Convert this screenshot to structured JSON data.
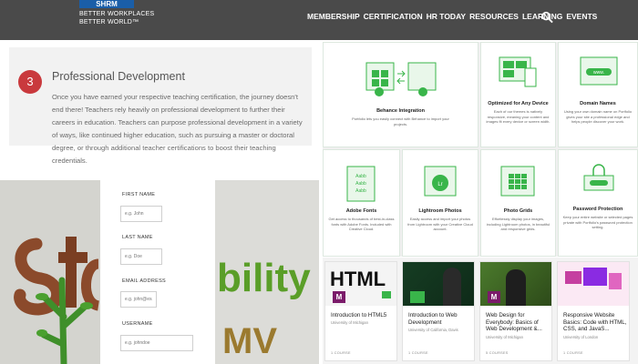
{
  "header": {
    "logo_text": "SHRM",
    "tagline_line1": "BETTER WORKPLACES",
    "tagline_line2": "BETTER WORLD™",
    "nav": [
      "MEMBERSHIP",
      "CERTIFICATION",
      "HR TODAY",
      "RESOURCES",
      "LEARNING",
      "EVENTS"
    ],
    "search_icon": "search-icon"
  },
  "development": {
    "step_number": "3",
    "title": "Professional Development",
    "body": "Once you have earned your respective teaching certification, the journey doesn't end there! Teachers rely heavily on professional development to further their careers in education. Teachers can purpose professional development in a variety of ways, like continued higher education, such as pursuing a master or doctoral degree, or through additional teacher certifications to boost their teaching credentials."
  },
  "form": {
    "fields": [
      {
        "label": "FIRST NAME",
        "placeholder": "e.g. John"
      },
      {
        "label": "LAST NAME",
        "placeholder": "e.g. Doe"
      },
      {
        "label": "EMAIL ADDRESS",
        "placeholder": "e.g. john@example.com"
      },
      {
        "label": "USERNAME",
        "placeholder": "e.g. johndoe"
      }
    ]
  },
  "features": [
    {
      "title": "Behance Integration",
      "desc": "Portfolio lets you easily connect with Behance to import your projects."
    },
    {
      "title": "Optimized for Any Device",
      "desc": "Each of our themes is natively responsive, meaning your content and images fit every device or screen width."
    },
    {
      "title": "Domain Names",
      "desc": "Using your own domain name on Portfolio gives your site a professional edge and helps people discover your work."
    },
    {
      "title": "Adobe Fonts",
      "desc": "Get access to thousands of best-in-class fonts with Adobe Fonts. Included with Creative Cloud."
    },
    {
      "title": "Lightroom Photos",
      "desc": "Easily access and import your photos from Lightroom with your Creative Cloud account."
    },
    {
      "title": "Photo Grids",
      "desc": "Effortlessly display your images, including Lightroom photos, in beautiful and responsive grids."
    },
    {
      "title": "Password Protection",
      "desc": "Keep your entire website or selected pages private with Portfolio's password protection setting."
    }
  ],
  "courses": [
    {
      "title": "Introduction to HTML5",
      "institution": "University of Michigan",
      "count": "1 COURSE",
      "thumb_text": "HTML"
    },
    {
      "title": "Introduction to Web Development",
      "institution": "University of California, Davis",
      "count": "1 COURSE",
      "thumb_text": ""
    },
    {
      "title": "Web Design for Everybody: Basics of Web Development &...",
      "institution": "University of Michigan",
      "count": "5 COURSES",
      "thumb_text": ""
    },
    {
      "title": "Responsive Website Basics: Code with HTML, CSS, and JavaS...",
      "institution": "University of London",
      "count": "1 COURSE",
      "thumb_text": ""
    }
  ],
  "colors": {
    "header_bg": "#4a4a4a",
    "accent_red": "#c9393d",
    "accent_green": "#39b54a",
    "brand_blue": "#1a5ea8"
  }
}
